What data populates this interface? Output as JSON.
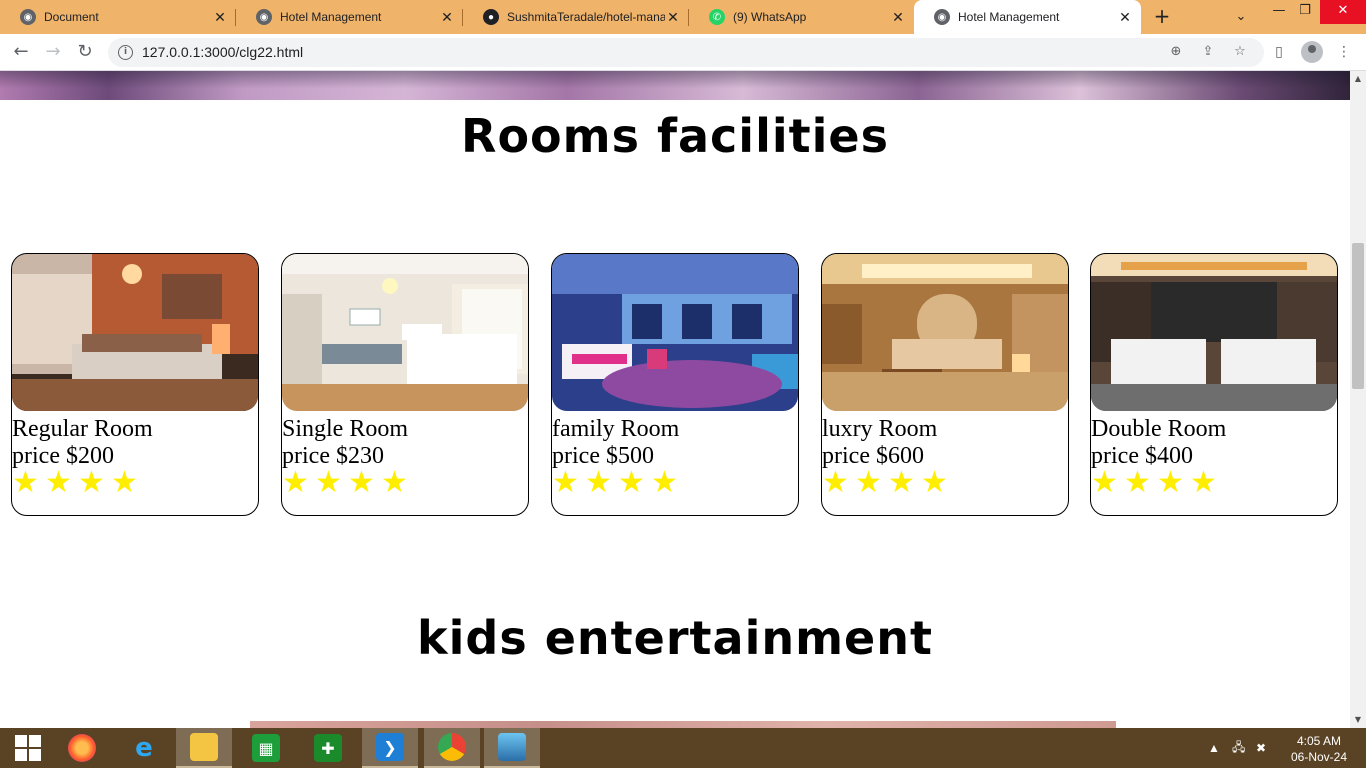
{
  "browser": {
    "tabs": [
      {
        "label": "Document",
        "icon": "globe-icon"
      },
      {
        "label": "Hotel Management",
        "icon": "globe-icon"
      },
      {
        "label": "SushmitaTeradale/hotel-mana",
        "icon": "github-icon"
      },
      {
        "label": "(9) WhatsApp",
        "icon": "whatsapp-icon"
      },
      {
        "label": "Hotel Management",
        "icon": "globe-icon",
        "active": true
      }
    ],
    "url": "127.0.0.1:3000/clg22.html",
    "new_tab_symbol": "+",
    "close_symbol": "✕"
  },
  "page": {
    "rooms_title": "Rooms facilities",
    "kids_title": "kids entertainment",
    "star_symbol": "★",
    "rooms": [
      {
        "name": "Regular Room",
        "price": "price $200",
        "rating": 4
      },
      {
        "name": "Single Room",
        "price": "price $230",
        "rating": 4
      },
      {
        "name": "family Room",
        "price": "price $500",
        "rating": 4
      },
      {
        "name": "luxry Room",
        "price": "price $600",
        "rating": 4
      },
      {
        "name": "Double Room",
        "price": "price $400",
        "rating": 4
      }
    ]
  },
  "taskbar": {
    "time": "4:05 AM",
    "date": "06-Nov-24"
  }
}
